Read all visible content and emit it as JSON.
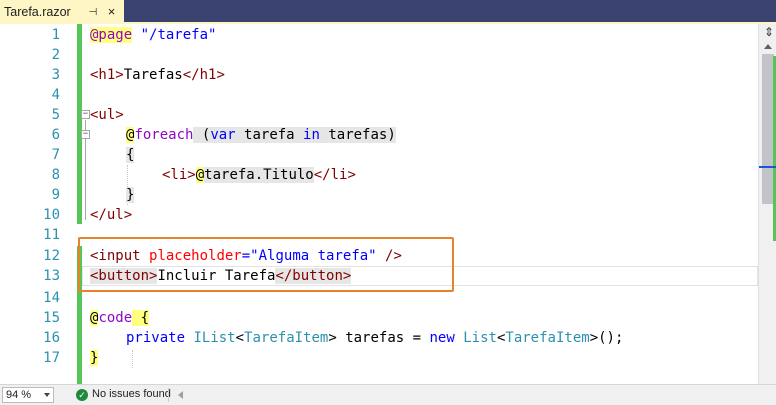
{
  "tab": {
    "title": "Tarefa.razor",
    "pin_glyph": "⊣",
    "close_glyph": "×"
  },
  "line_numbers": [
    "1",
    "2",
    "3",
    "4",
    "5",
    "6",
    "7",
    "8",
    "9",
    "10",
    "11",
    "12",
    "13",
    "14",
    "15",
    "16",
    "17"
  ],
  "code": {
    "l1_dir": "@page",
    "l1_str": "\"/tarefa\"",
    "l3_open": "<h1>",
    "l3_text": "Tarefas",
    "l3_close": "</h1>",
    "l5": "<ul>",
    "l6_at": "@",
    "l6_kw": "foreach",
    "l6_paren": " (",
    "l6_var": "var",
    "l6_ident": " tarefa ",
    "l6_in": "in",
    "l6_rest": " tarefas)",
    "l7": "{",
    "l8_open": "<li>",
    "l8_at": "@",
    "l8_expr": "tarefa.Titulo",
    "l8_close": "</li>",
    "l9": "}",
    "l10": "</ul>",
    "l12_tag": "<input",
    "l12_attr": "placeholder",
    "l12_eq": "=",
    "l12_str": "\"Alguma tarefa\"",
    "l12_end": " />",
    "l13_open": "<button>",
    "l13_text": "Incluir Tarefa",
    "l13_close": "</button>",
    "l15_at": "@",
    "l15_kw": "code",
    "l15_brace": " {",
    "l16_private": "private",
    "l16_type1": "IList",
    "l16_lt": "<",
    "l16_type2": "TarefaItem",
    "l16_gt": "> tarefas = ",
    "l16_new": "new",
    "l16_type3": "List",
    "l16_lt2": "<",
    "l16_type4": "TarefaItem",
    "l16_end": ">();",
    "l17": "}"
  },
  "scrollbar": {
    "split_glyph": "⇕"
  },
  "status": {
    "zoom": "94 %",
    "message": "No issues found",
    "ok_glyph": "✓"
  },
  "colors": {
    "tab_bg": "#fff6c5",
    "frame": "#3a4370",
    "highlight_box": "#e8822a",
    "change_bar": "#57c457"
  }
}
